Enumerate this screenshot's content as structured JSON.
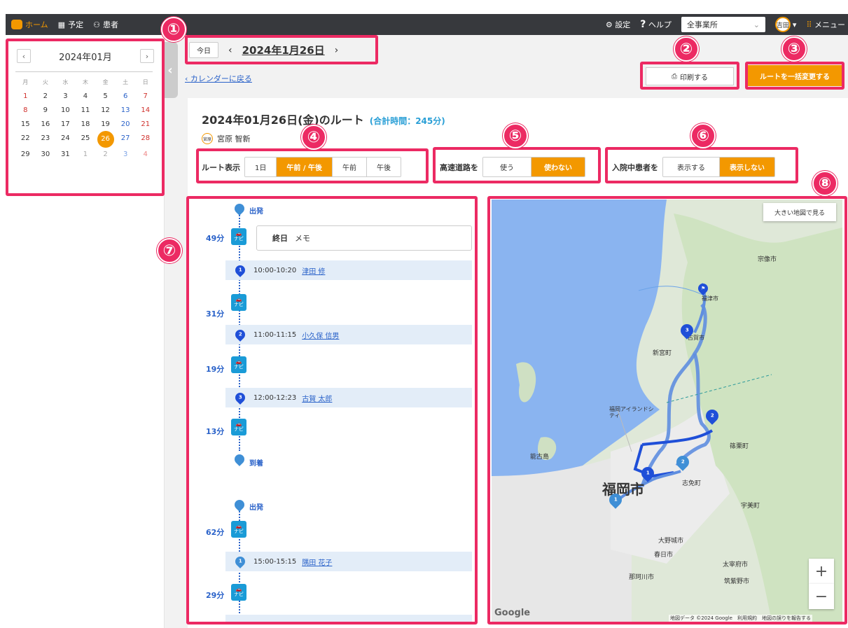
{
  "topbar": {
    "home": "ホーム",
    "schedule": "予定",
    "patients": "患者",
    "settings": "設定",
    "help": "ヘルプ",
    "office": "全事業所",
    "user": "吉田",
    "menu": "メニュー"
  },
  "calendar": {
    "month": "2024年01月",
    "dow": [
      "月",
      "火",
      "水",
      "木",
      "金",
      "土",
      "日"
    ],
    "weeks": [
      [
        "1",
        "2",
        "3",
        "4",
        "5",
        "6",
        "7"
      ],
      [
        "8",
        "9",
        "10",
        "11",
        "12",
        "13",
        "14"
      ],
      [
        "15",
        "16",
        "17",
        "18",
        "19",
        "20",
        "21"
      ],
      [
        "22",
        "23",
        "24",
        "25",
        "26",
        "27",
        "28"
      ],
      [
        "29",
        "30",
        "31",
        "1",
        "2",
        "3",
        "4"
      ]
    ],
    "selected": "26"
  },
  "datenav": {
    "today": "今日",
    "date": "2024年1月26日"
  },
  "back_link": "カレンダーに戻る",
  "print_btn": "印刷する",
  "bulk_btn": "ルートを一括変更する",
  "route": {
    "title": "2024年01月26日(金)のルート",
    "total": "(合計時間：245分)",
    "patient_badge": "宮原",
    "patient_name": "宮原 智新"
  },
  "filters": {
    "route_label": "ルート表示",
    "route_opts": [
      "1日",
      "午前 / 午後",
      "午前",
      "午後"
    ],
    "highway_label": "高速道路を",
    "highway_opts": [
      "使う",
      "使わない"
    ],
    "inpatient_label": "入院中患者を",
    "inpatient_opts": [
      "表示する",
      "表示しない"
    ]
  },
  "timeline": {
    "depart": "出発",
    "arrive": "到着",
    "navi": "ナビ",
    "memo_label": "終日",
    "memo_text": "メモ",
    "legs": [
      "49分",
      "31分",
      "19分",
      "13分",
      "62分",
      "29分"
    ],
    "visits": [
      {
        "no": "1",
        "time": "10:00-10:20",
        "name": "津田 修"
      },
      {
        "no": "2",
        "time": "11:00-11:15",
        "name": "小久保 信男"
      },
      {
        "no": "3",
        "time": "12:00-12:23",
        "name": "古賀 太郎"
      },
      {
        "no": "1",
        "time": "15:00-15:15",
        "name": "隅田 花子"
      }
    ],
    "depart2": "出発"
  },
  "map": {
    "big_btn": "大きい地図で見る",
    "footer": "地図データ ©2024 Google　利用規約　地図の誤りを報告する",
    "google": "Google",
    "labels": [
      "福岡市",
      "宗像市",
      "福津市",
      "古賀市",
      "新宮町",
      "福岡アイランドシティ",
      "能古島",
      "篠栗町",
      "志免町",
      "宇美町",
      "大野城市",
      "春日市",
      "太宰府市",
      "那珂川市",
      "筑紫野市"
    ]
  },
  "annotations": [
    "①",
    "②",
    "③",
    "④",
    "⑤",
    "⑥",
    "⑦",
    "⑧"
  ],
  "colors": {
    "accent": "#f39800",
    "highlight": "#ec2a63",
    "link": "#2a62c9",
    "topbar": "#37393d"
  }
}
